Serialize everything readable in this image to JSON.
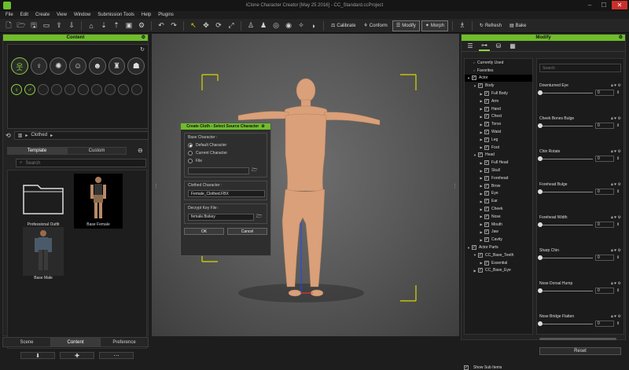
{
  "window": {
    "title": "iClone Character Creator [May 25 2016] - CC_Standard.ccProject"
  },
  "menu": [
    "File",
    "Edit",
    "Create",
    "View",
    "Window",
    "Submission Tools",
    "Help",
    "Plugins"
  ],
  "toolbar": {
    "calibrate": "Calibrate",
    "conform": "Conform",
    "modify": "Modify",
    "morph": "Morph",
    "refresh": "Refresh",
    "bake": "Bake"
  },
  "content_panel": {
    "title": "Content",
    "breadcrumb": "Clothed",
    "tabs": [
      "Template",
      "Custom"
    ],
    "search_placeholder": "Search",
    "items": [
      {
        "label": "Professional Outfit"
      },
      {
        "label": "Base Female"
      },
      {
        "label": "Base Male"
      }
    ]
  },
  "bottom_tabs": [
    "Scene",
    "Content",
    "Preference"
  ],
  "dialog": {
    "title": "Create Cloth - Select Source Character",
    "base_group": "Base Character :",
    "options": [
      "Default Character",
      "Current Character",
      "File"
    ],
    "clothed_group": "Clothed Character :",
    "clothed_value": "Female_Clothed.FBX",
    "decrypt_group": "Decrypt Key File :",
    "decrypt_value": "female.fbxkey",
    "ok": "OK",
    "cancel": "Cancel"
  },
  "modify_panel": {
    "title": "Modify",
    "search_placeholder": "Search",
    "reset": "Reset",
    "show_sub_items": "Show Sub Items",
    "tree": [
      {
        "label": "Currently Used",
        "indent": 0,
        "kind": "dot"
      },
      {
        "label": "Favorites",
        "indent": 0,
        "kind": "dot"
      },
      {
        "label": "Actor",
        "indent": 0,
        "kind": "check",
        "expanded": true,
        "selected": true
      },
      {
        "label": "Body",
        "indent": 1,
        "kind": "check",
        "expanded": true
      },
      {
        "label": "Full Body",
        "indent": 2,
        "kind": "check"
      },
      {
        "label": "Arm",
        "indent": 2,
        "kind": "check"
      },
      {
        "label": "Hand",
        "indent": 2,
        "kind": "check"
      },
      {
        "label": "Chest",
        "indent": 2,
        "kind": "check"
      },
      {
        "label": "Torso",
        "indent": 2,
        "kind": "check"
      },
      {
        "label": "Waist",
        "indent": 2,
        "kind": "check"
      },
      {
        "label": "Leg",
        "indent": 2,
        "kind": "check"
      },
      {
        "label": "Foot",
        "indent": 2,
        "kind": "check"
      },
      {
        "label": "Head",
        "indent": 1,
        "kind": "check",
        "expanded": true
      },
      {
        "label": "Full Head",
        "indent": 2,
        "kind": "check"
      },
      {
        "label": "Skull",
        "indent": 2,
        "kind": "check"
      },
      {
        "label": "Forehead",
        "indent": 2,
        "kind": "check"
      },
      {
        "label": "Brow",
        "indent": 2,
        "kind": "check"
      },
      {
        "label": "Eye",
        "indent": 2,
        "kind": "check"
      },
      {
        "label": "Ear",
        "indent": 2,
        "kind": "check"
      },
      {
        "label": "Cheek",
        "indent": 2,
        "kind": "check"
      },
      {
        "label": "Nose",
        "indent": 2,
        "kind": "check"
      },
      {
        "label": "Mouth",
        "indent": 2,
        "kind": "check"
      },
      {
        "label": "Jaw",
        "indent": 2,
        "kind": "check"
      },
      {
        "label": "Cavity",
        "indent": 2,
        "kind": "check"
      },
      {
        "label": "Actor Parts",
        "indent": 0,
        "kind": "check",
        "expanded": true
      },
      {
        "label": "CC_Base_Teeth",
        "indent": 1,
        "kind": "check",
        "expanded": true
      },
      {
        "label": "Essential",
        "indent": 2,
        "kind": "check"
      },
      {
        "label": "CC_Base_Eye",
        "indent": 1,
        "kind": "check"
      }
    ],
    "sliders": [
      {
        "label": "Downturned Eye",
        "value": "0"
      },
      {
        "label": "Cheek Bones Bulge",
        "value": "0"
      },
      {
        "label": "Chin Rotate",
        "value": "0"
      },
      {
        "label": "Forehead Bulge",
        "value": "0"
      },
      {
        "label": "Forehead Width",
        "value": "0"
      },
      {
        "label": "Sharp Chin",
        "value": "0"
      },
      {
        "label": "Nose Dorsal Hump",
        "value": "0"
      },
      {
        "label": "Nose Bridge Flatten",
        "value": "0"
      }
    ]
  }
}
